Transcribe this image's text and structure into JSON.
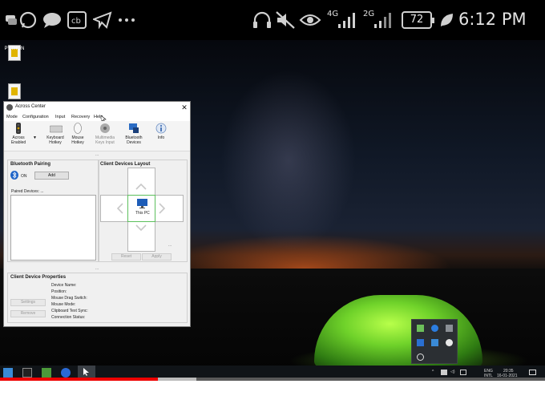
{
  "phone_status": {
    "signal_4g": "4G",
    "signal_2g": "2G",
    "battery": "72",
    "time": "6:12 PM"
  },
  "desktop": {
    "icons": [
      {
        "label": "PYTHON"
      },
      {
        "label": ""
      }
    ]
  },
  "window": {
    "title": "Across Center",
    "menu": [
      "Mode",
      "Configuration",
      "Input",
      "Recovery",
      "Help"
    ],
    "toolbar": [
      {
        "label": "Across\nEnabled",
        "icon": "traffic-light-icon"
      },
      {
        "label": "Keyboard\nHotkey",
        "icon": "keyboard-icon"
      },
      {
        "label": "Mouse\nHotkey",
        "icon": "mouse-icon"
      },
      {
        "label": "Multimedia\nKeys Input",
        "icon": "multimedia-icon",
        "disabled": true
      },
      {
        "label": "Bluetooth\nDevices",
        "icon": "bluetooth-devices-icon"
      },
      {
        "label": "Info",
        "icon": "info-icon"
      }
    ],
    "separator_dots": "...",
    "bluetooth_pairing": {
      "title": "Bluetooth Pairing",
      "state": "ON",
      "add_label": "Add",
      "paired_label": "Paired Devices: ..."
    },
    "client_layout": {
      "title": "Client Devices Layout",
      "center_label": "This PC",
      "reset_label": "Reset",
      "apply_label": "Apply",
      "dots": "..."
    },
    "properties": {
      "title": "Client Device Properties",
      "settings_label": "Settings",
      "remove_label": "Remove",
      "fields": [
        "Device Name:",
        "Position:",
        "Mouse Drag Switch:",
        "Mouse Mode:",
        "Clipboard Text Sync:",
        "Connection Status:"
      ]
    }
  },
  "tray": {
    "lang_top": "ENG",
    "lang_bottom": "INTL",
    "time": "20:35",
    "date": "16-01-2021"
  },
  "video_progress": {
    "played_fraction": 0.29,
    "buffered_fraction": 0.36
  },
  "colors": {
    "progress_played": "#ee0000",
    "accent_green": "#3cb043"
  }
}
